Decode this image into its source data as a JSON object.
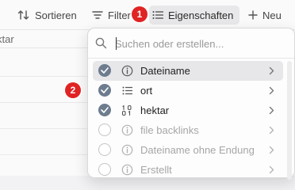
{
  "toolbar": {
    "sort_label": "Sortieren",
    "filter_label": "Filter",
    "properties_label": "Eigenschaften",
    "new_label": "Neu"
  },
  "annotations": {
    "badge_1": "1",
    "badge_2": "2"
  },
  "table": {
    "column_header": "ktar"
  },
  "properties_menu": {
    "search_placeholder": "Suchen oder erstellen...",
    "items": [
      {
        "label": "Dateiname",
        "icon": "info-icon",
        "checked": true
      },
      {
        "label": "ort",
        "icon": "list-icon",
        "checked": true
      },
      {
        "label": "hektar",
        "icon": "number-icon",
        "checked": true
      },
      {
        "label": "file backlinks",
        "icon": "info-icon",
        "checked": false
      },
      {
        "label": "Dateiname ohne Endung",
        "icon": "info-icon",
        "checked": false
      },
      {
        "label": "Erstellt",
        "icon": "info-icon",
        "checked": false
      }
    ]
  },
  "colors": {
    "badge": "#e02424",
    "checked": "#6d7c8e",
    "selected_row": "#e7e7ea"
  }
}
